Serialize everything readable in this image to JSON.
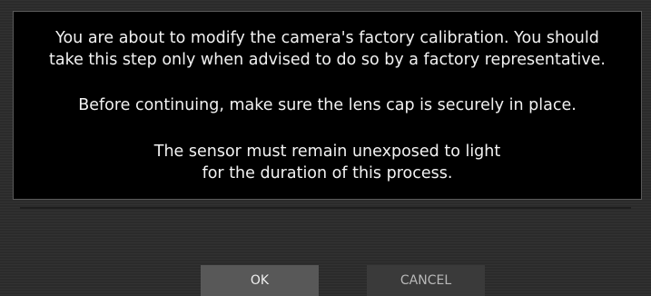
{
  "dialog": {
    "message": {
      "paragraph1": [
        "You are about to modify the camera's factory calibration. You should",
        "take this step only when advised to do so by a factory representative."
      ],
      "paragraph2": [
        "Before continuing, make sure the lens cap is securely in place."
      ],
      "paragraph3": [
        "The sensor must remain unexposed to light",
        "for the duration of this process."
      ]
    },
    "buttons": {
      "ok_label": "OK",
      "cancel_label": "CANCEL"
    }
  },
  "colors": {
    "panel_background": "#000000",
    "dialog_background": "#2b2b2b",
    "text": "#f2f2f2",
    "ok_button": "#585858",
    "cancel_button": "#3a3a3a"
  }
}
